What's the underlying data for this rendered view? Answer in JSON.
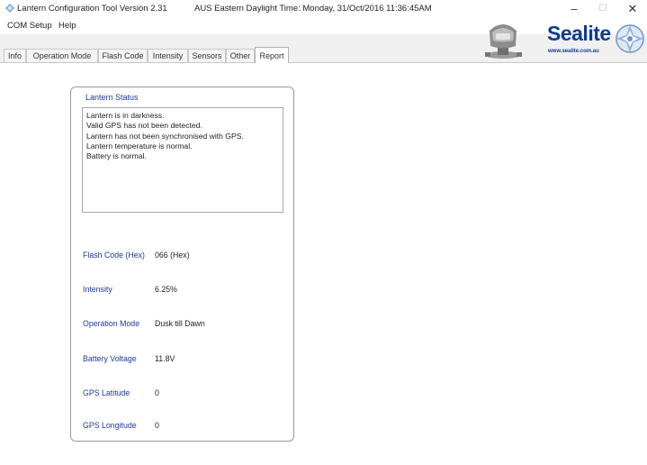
{
  "window": {
    "title": "Lantern Configuration Tool Version 2.31",
    "datetime": "AUS Eastern Daylight Time: Monday, 31/Oct/2016 11:36:45AM",
    "controls": {
      "minimize": "–",
      "maximize": "☐",
      "close": "✕"
    }
  },
  "menu": {
    "items": [
      "COM Setup",
      "Help"
    ]
  },
  "brand": {
    "name": "Sealite",
    "url": "www.sealite.com.au"
  },
  "tabs": [
    "Info",
    "Operation Mode",
    "Flash Code",
    "Intensity",
    "Sensors",
    "Other",
    "Report"
  ],
  "active_tab": "Report",
  "report": {
    "group_title": "Lantern Status",
    "status_lines": [
      "Lantern is in darkness.",
      "Valid GPS has not been detected.",
      "Lantern has not been synchronised with GPS.",
      "Lantern temperature is normal.",
      "Battery is normal."
    ],
    "fields": [
      {
        "label": "Flash Code (Hex)",
        "value": "066 (Hex)"
      },
      {
        "label": "Intensity",
        "value": "6.25%"
      },
      {
        "label": "Operation Mode",
        "value": "Dusk till Dawn"
      },
      {
        "label": "Battery Voltage",
        "value": "11.8V"
      },
      {
        "label": "GPS Latitude",
        "value": "0"
      },
      {
        "label": "GPS Longitude",
        "value": "0"
      }
    ]
  },
  "colors": {
    "accent": "#1f3a93",
    "brand": "#0b3d91"
  }
}
